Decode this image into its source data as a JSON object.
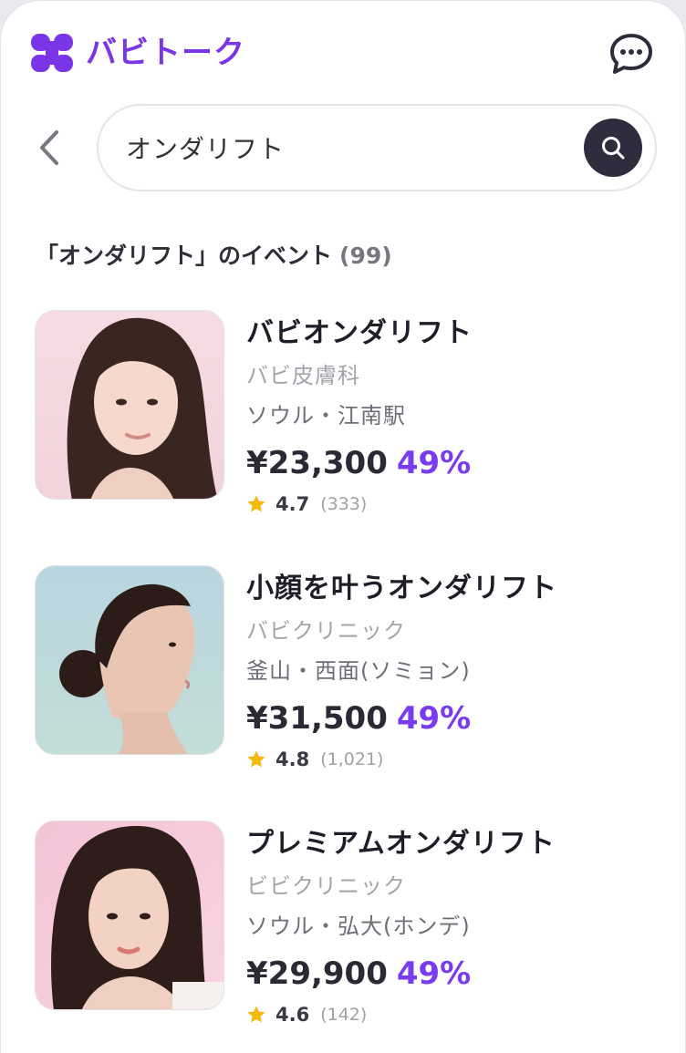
{
  "header": {
    "app_name": "バビトーク",
    "logo_icon": "butterfly-logo",
    "chat_icon": "chat-bubble-icon",
    "brand_color": "#7b35e8"
  },
  "search": {
    "back_icon": "chevron-left-icon",
    "query": "オンダリフト",
    "button_icon": "search-icon"
  },
  "results": {
    "heading": "「オンダリフト」のイベント",
    "count": "(99)"
  },
  "events": [
    {
      "title": "バビオンダリフト",
      "clinic": "バビ皮膚科",
      "location": "ソウル・江南駅",
      "price": "¥23,300",
      "discount": "49%",
      "rating": "4.7",
      "reviews": "(333)"
    },
    {
      "title": "小顔を叶うオンダリフト",
      "clinic": "バビクリニック",
      "location": "釜山・西面(ソミョン)",
      "price": "¥31,500",
      "discount": "49%",
      "rating": "4.8",
      "reviews": "(1,021)"
    },
    {
      "title": "プレミアムオンダリフト",
      "clinic": "ビビクリニック",
      "location": "ソウル・弘大(ホンデ)",
      "price": "¥29,900",
      "discount": "49%",
      "rating": "4.6",
      "reviews": "(142)"
    }
  ],
  "colors": {
    "discount": "#7a3cf0",
    "star": "#f5b90a",
    "search_button": "#2d2d3d"
  }
}
